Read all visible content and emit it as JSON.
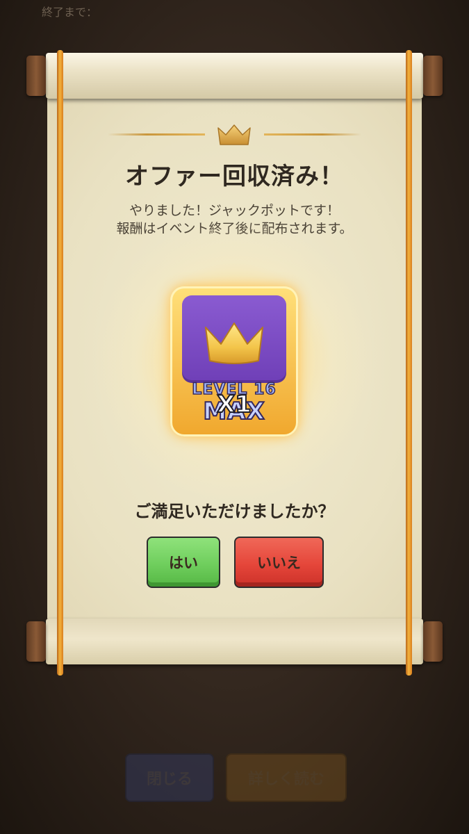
{
  "background": {
    "top_label": "終了まで：",
    "close_button": "閉じる",
    "read_more_button": "詳しく読む"
  },
  "dialog": {
    "title": "オファー回収済み！",
    "description_line1": "やりました！ジャックポットです！",
    "description_line2": "報酬はイベント終了後に配布されます。",
    "reward": {
      "icon": "crown-icon",
      "level_text": "LEVEL 16",
      "max_text": "MAX",
      "quantity": "X1"
    },
    "question": "ご満足いただけましたか？",
    "yes_button": "はい",
    "no_button": "いいえ"
  },
  "colors": {
    "yes": "#6fce5d",
    "no": "#e5463a",
    "card_purple": "#7a49c2",
    "gold": "#f4b33c"
  }
}
